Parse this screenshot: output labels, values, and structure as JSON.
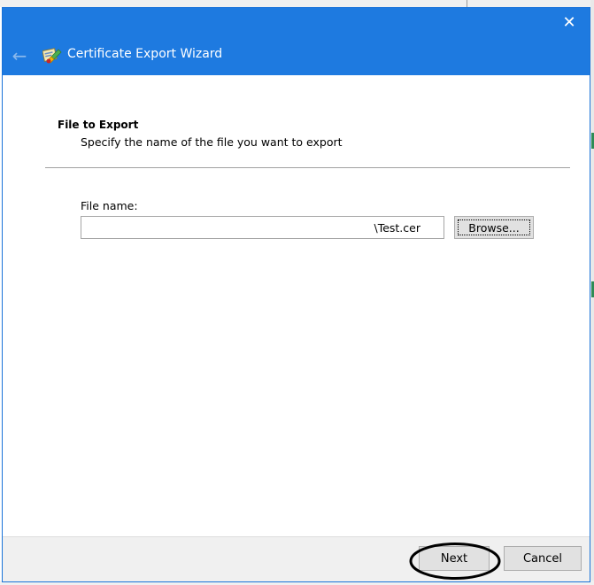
{
  "window": {
    "close_glyph": "✕"
  },
  "header": {
    "title": "Certificate Export Wizard",
    "back_glyph": "←",
    "back_icon": "back-arrow-icon",
    "cert_icon": "certificate-icon"
  },
  "section": {
    "title": "File to Export",
    "description": "Specify the name of the file you want to export"
  },
  "file": {
    "label": "File name:",
    "value": "\\Test.cer"
  },
  "buttons": {
    "browse": "Browse...",
    "next": "Next",
    "cancel": "Cancel"
  },
  "colors": {
    "titlebar": "#1e7ae0",
    "annotation": "#000000"
  }
}
